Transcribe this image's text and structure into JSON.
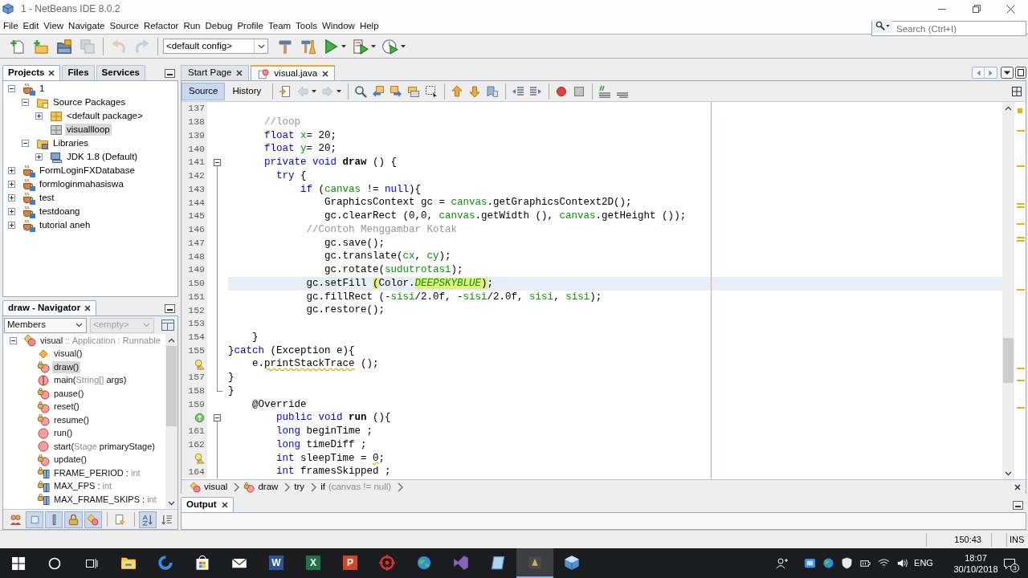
{
  "window": {
    "title": "1 - NetBeans IDE 8.0.2"
  },
  "menu": [
    "File",
    "Edit",
    "View",
    "Navigate",
    "Source",
    "Refactor",
    "Run",
    "Debug",
    "Profile",
    "Team",
    "Tools",
    "Window",
    "Help"
  ],
  "search": {
    "placeholder": "Search (Ctrl+I)"
  },
  "toolbar": [
    {
      "kind": "new-file",
      "disabled": false
    },
    {
      "kind": "new-project",
      "disabled": false
    },
    {
      "kind": "open-project",
      "disabled": false
    },
    {
      "kind": "save-all",
      "disabled": true
    },
    {
      "kind": "separator"
    },
    {
      "kind": "undo",
      "disabled": true
    },
    {
      "kind": "redo",
      "disabled": true
    },
    {
      "kind": "separator"
    },
    {
      "kind": "config",
      "value": "<default config>"
    },
    {
      "kind": "build",
      "disabled": false
    },
    {
      "kind": "clean-build",
      "disabled": false
    },
    {
      "kind": "run",
      "disabled": false
    },
    {
      "kind": "debug",
      "disabled": false
    },
    {
      "kind": "profile",
      "disabled": false
    }
  ],
  "projects": {
    "tabs": [
      {
        "label": "Projects",
        "selected": true,
        "closable": true
      },
      {
        "label": "Files",
        "selected": false,
        "closable": false
      },
      {
        "label": "Services",
        "selected": false,
        "closable": false
      }
    ],
    "tree": [
      {
        "kind": "project",
        "label": "1",
        "expanded": true,
        "selected": false,
        "children": [
          {
            "kind": "sources",
            "label": "Source Packages",
            "expanded": true,
            "selected": false,
            "children": [
              {
                "kind": "package",
                "label": "<default package>",
                "expanded": false,
                "selected": false
              },
              {
                "kind": "empty-package",
                "label": "visuallloop",
                "selected": true
              }
            ]
          },
          {
            "kind": "libraries",
            "label": "Libraries",
            "expanded": true,
            "selected": false,
            "children": [
              {
                "kind": "jdk",
                "label": "JDK 1.8 (Default)",
                "expanded": false,
                "selected": false
              }
            ]
          }
        ]
      },
      {
        "kind": "project",
        "label": "FormLoginFXDatabase",
        "expanded": false,
        "selected": false
      },
      {
        "kind": "project",
        "label": "formloginmahasiswa",
        "expanded": false,
        "selected": false
      },
      {
        "kind": "project",
        "label": "test",
        "expanded": false,
        "selected": false
      },
      {
        "kind": "project",
        "label": "testdoang",
        "expanded": false,
        "selected": false
      },
      {
        "kind": "project",
        "label": "tutorial aneh",
        "expanded": false,
        "selected": false
      }
    ]
  },
  "navigator": {
    "title": "draw - Navigator",
    "filter": {
      "value": "Members",
      "disabled": false
    },
    "scope": {
      "value": "<empty>",
      "disabled": true
    },
    "members": [
      {
        "kind": "class",
        "expanded": true,
        "selected": false,
        "parts": [
          {
            "kind": "name",
            "text": "visual"
          },
          {
            "kind": "type",
            "text": " :: Application : Runnable"
          }
        ],
        "children": [
          {
            "kind": "constructor",
            "selected": false,
            "parts": [
              {
                "kind": "name",
                "text": "visual()"
              }
            ]
          },
          {
            "kind": "private-method",
            "selected": true,
            "parts": [
              {
                "kind": "name",
                "text": "draw()"
              }
            ]
          },
          {
            "kind": "static-method",
            "selected": false,
            "parts": [
              {
                "kind": "name",
                "text": "main("
              },
              {
                "kind": "type",
                "text": "String[]"
              },
              {
                "kind": "name",
                "text": " args)"
              }
            ]
          },
          {
            "kind": "private-method",
            "selected": false,
            "parts": [
              {
                "kind": "name",
                "text": "pause()"
              }
            ]
          },
          {
            "kind": "private-method",
            "selected": false,
            "parts": [
              {
                "kind": "name",
                "text": "reset()"
              }
            ]
          },
          {
            "kind": "private-method",
            "selected": false,
            "parts": [
              {
                "kind": "name",
                "text": "resume()"
              }
            ]
          },
          {
            "kind": "public-method",
            "selected": false,
            "parts": [
              {
                "kind": "name",
                "text": "run()"
              }
            ]
          },
          {
            "kind": "public-method",
            "selected": false,
            "parts": [
              {
                "kind": "name",
                "text": "start("
              },
              {
                "kind": "type",
                "text": "Stage"
              },
              {
                "kind": "name",
                "text": " primaryStage)"
              }
            ]
          },
          {
            "kind": "private-method",
            "selected": false,
            "parts": [
              {
                "kind": "name",
                "text": "update()"
              }
            ]
          },
          {
            "kind": "private-field",
            "selected": false,
            "parts": [
              {
                "kind": "name",
                "text": "FRAME_PERIOD : "
              },
              {
                "kind": "type",
                "text": "int"
              }
            ]
          },
          {
            "kind": "private-field",
            "selected": false,
            "parts": [
              {
                "kind": "name",
                "text": "MAX_FPS : "
              },
              {
                "kind": "type",
                "text": "int"
              }
            ]
          },
          {
            "kind": "private-field",
            "selected": false,
            "parts": [
              {
                "kind": "name",
                "text": "MAX_FRAME_SKIPS : "
              },
              {
                "kind": "type",
                "text": "int"
              }
            ]
          }
        ]
      }
    ],
    "filters": [
      {
        "kind": "inherited",
        "on": false
      },
      {
        "kind": "fields",
        "on": true
      },
      {
        "kind": "static",
        "on": true
      },
      {
        "kind": "non-public",
        "on": true
      },
      {
        "kind": "inner-classes",
        "on": true
      },
      {
        "kind": "separator"
      },
      {
        "kind": "javadoc",
        "on": false
      },
      {
        "kind": "separator"
      },
      {
        "kind": "sort-name",
        "on": true
      },
      {
        "kind": "sort-source",
        "on": false
      }
    ]
  },
  "editor": {
    "tabs": [
      {
        "kind": "page",
        "label": "Start Page",
        "selected": false
      },
      {
        "kind": "java",
        "label": "visual.java",
        "selected": true
      }
    ],
    "views": [
      {
        "label": "Source",
        "selected": true
      },
      {
        "label": "History",
        "selected": false
      }
    ],
    "tools": [
      {
        "kind": "separator"
      },
      {
        "kind": "last-edit",
        "disabled": false
      },
      {
        "kind": "back",
        "disabled": true
      },
      {
        "kind": "forward",
        "disabled": true
      },
      {
        "kind": "separator"
      },
      {
        "kind": "find",
        "disabled": false
      },
      {
        "kind": "find-prev",
        "disabled": false
      },
      {
        "kind": "find-next",
        "disabled": false
      },
      {
        "kind": "highlight",
        "disabled": false
      },
      {
        "kind": "find-selection",
        "disabled": false
      },
      {
        "kind": "separator"
      },
      {
        "kind": "prev-bookmark",
        "disabled": false
      },
      {
        "kind": "next-bookmark",
        "disabled": false
      },
      {
        "kind": "toggle-bookmark",
        "disabled": false
      },
      {
        "kind": "separator"
      },
      {
        "kind": "shift-left",
        "disabled": false
      },
      {
        "kind": "shift-right",
        "disabled": false
      },
      {
        "kind": "separator"
      },
      {
        "kind": "record",
        "disabled": false
      },
      {
        "kind": "stop",
        "disabled": false
      },
      {
        "kind": "separator"
      },
      {
        "kind": "comment",
        "disabled": false
      },
      {
        "kind": "uncomment",
        "disabled": false
      }
    ],
    "lines": [
      {
        "number": "137",
        "kind": "plain",
        "current": false
      },
      {
        "number": "138",
        "kind": "plain",
        "current": false,
        "tokens": [
          {
            "kind": "comment",
            "text": "      //loop"
          }
        ]
      },
      {
        "number": "139",
        "kind": "plain",
        "current": false,
        "tokens": [
          {
            "kind": "keyword",
            "text": "      float "
          },
          {
            "kind": "field",
            "text": "x"
          },
          {
            "kind": "plain",
            "text": "= 20;"
          }
        ]
      },
      {
        "number": "140",
        "kind": "plain",
        "current": false,
        "tokens": [
          {
            "kind": "keyword",
            "text": "      float "
          },
          {
            "kind": "field",
            "text": "y"
          },
          {
            "kind": "plain",
            "text": "= 20;"
          }
        ]
      },
      {
        "number": "141",
        "kind": "fold-start",
        "current": false,
        "tokens": [
          {
            "kind": "keyword",
            "text": "      private void "
          },
          {
            "kind": "bold",
            "text": "draw"
          },
          {
            "kind": "plain",
            "text": " () {"
          }
        ]
      },
      {
        "number": "142",
        "kind": "fold-body",
        "current": false,
        "tokens": [
          {
            "kind": "keyword",
            "text": "        try"
          },
          {
            "kind": "plain",
            "text": " {"
          }
        ]
      },
      {
        "number": "143",
        "kind": "fold-body",
        "current": false,
        "tokens": [
          {
            "kind": "keyword",
            "text": "            if"
          },
          {
            "kind": "plain",
            "text": " ("
          },
          {
            "kind": "field",
            "text": "canvas"
          },
          {
            "kind": "plain",
            "text": " != "
          },
          {
            "kind": "keyword",
            "text": "null"
          },
          {
            "kind": "plain",
            "text": "){"
          }
        ]
      },
      {
        "number": "144",
        "kind": "fold-body",
        "current": false,
        "tokens": [
          {
            "kind": "plain",
            "text": "                GraphicsContext gc = "
          },
          {
            "kind": "field",
            "text": "canvas"
          },
          {
            "kind": "plain",
            "text": ".getGraphicsContext2D();"
          }
        ]
      },
      {
        "number": "145",
        "kind": "fold-body",
        "current": false,
        "tokens": [
          {
            "kind": "plain",
            "text": "                gc.clearRect (0,0, "
          },
          {
            "kind": "field",
            "text": "canvas"
          },
          {
            "kind": "plain",
            "text": ".getWidth (), "
          },
          {
            "kind": "field",
            "text": "canvas"
          },
          {
            "kind": "plain",
            "text": ".getHeight ());"
          }
        ]
      },
      {
        "number": "146",
        "kind": "fold-body",
        "current": false,
        "tokens": [
          {
            "kind": "comment",
            "text": "             //Contoh Menggambar Kotak"
          }
        ]
      },
      {
        "number": "147",
        "kind": "fold-body",
        "current": false,
        "tokens": [
          {
            "kind": "plain",
            "text": "                gc.save();"
          }
        ]
      },
      {
        "number": "148",
        "kind": "fold-body",
        "current": false,
        "tokens": [
          {
            "kind": "plain",
            "text": "                gc.translate("
          },
          {
            "kind": "field",
            "text": "cx"
          },
          {
            "kind": "plain",
            "text": ", "
          },
          {
            "kind": "field",
            "text": "cy"
          },
          {
            "kind": "plain",
            "text": ");"
          }
        ]
      },
      {
        "number": "149",
        "kind": "fold-body",
        "current": false,
        "tokens": [
          {
            "kind": "plain",
            "text": "                gc.rotate("
          },
          {
            "kind": "field",
            "text": "sudutrotasi"
          },
          {
            "kind": "plain",
            "text": ");"
          }
        ]
      },
      {
        "number": "150",
        "kind": "fold-body",
        "current": true,
        "tokens": [
          {
            "kind": "plain",
            "text": "             gc.setFill "
          },
          {
            "kind": "brace",
            "text": "("
          },
          {
            "kind": "plain",
            "text": "Color."
          },
          {
            "kind": "marked",
            "text": "DEEPSKYBLUE"
          },
          {
            "kind": "brace",
            "text": ")"
          },
          {
            "kind": "plain",
            "text": ";"
          }
        ]
      },
      {
        "number": "151",
        "kind": "fold-body",
        "current": false,
        "tokens": [
          {
            "kind": "plain",
            "text": "             gc.fillRect (-"
          },
          {
            "kind": "field",
            "text": "sisi"
          },
          {
            "kind": "plain",
            "text": "/2.0f, -"
          },
          {
            "kind": "field",
            "text": "sisi"
          },
          {
            "kind": "plain",
            "text": "/2.0f, "
          },
          {
            "kind": "field",
            "text": "sisi"
          },
          {
            "kind": "plain",
            "text": ", "
          },
          {
            "kind": "field",
            "text": "sisi"
          },
          {
            "kind": "plain",
            "text": ");"
          }
        ]
      },
      {
        "number": "152",
        "kind": "fold-body",
        "current": false,
        "tokens": [
          {
            "kind": "plain",
            "text": "             gc.restore();"
          }
        ]
      },
      {
        "number": "153",
        "kind": "fold-body",
        "current": false
      },
      {
        "number": "154",
        "kind": "fold-body",
        "current": false,
        "tokens": [
          {
            "kind": "plain",
            "text": "    }"
          }
        ]
      },
      {
        "number": "155",
        "kind": "fold-body",
        "current": false,
        "tokens": [
          {
            "kind": "plain",
            "text": "}"
          },
          {
            "kind": "keyword",
            "text": "catch"
          },
          {
            "kind": "plain",
            "text": " (Exception e){"
          }
        ]
      },
      {
        "annotation": {
          "kind": "hint"
        },
        "kind": "fold-body",
        "current": false,
        "tokens": [
          {
            "kind": "plain",
            "text": "    e."
          },
          {
            "kind": "warning",
            "text": "printStackTrace"
          },
          {
            "kind": "plain",
            "text": " ();"
          }
        ]
      },
      {
        "number": "157",
        "kind": "fold-body",
        "current": false,
        "tokens": [
          {
            "kind": "plain",
            "text": "}"
          }
        ]
      },
      {
        "number": "158",
        "kind": "fold-end",
        "current": false,
        "tokens": [
          {
            "kind": "plain",
            "text": "}"
          }
        ]
      },
      {
        "number": "159",
        "kind": "plain",
        "current": false,
        "tokens": [
          {
            "kind": "plain",
            "text": "    @Override"
          }
        ]
      },
      {
        "annotation": {
          "kind": "override"
        },
        "kind": "fold-start",
        "current": false,
        "tokens": [
          {
            "kind": "keyword",
            "text": "        public void "
          },
          {
            "kind": "bold",
            "text": "run"
          },
          {
            "kind": "plain",
            "text": " (){"
          }
        ]
      },
      {
        "number": "161",
        "kind": "fold-body",
        "current": false,
        "tokens": [
          {
            "kind": "keyword",
            "text": "        long"
          },
          {
            "kind": "plain",
            "text": " beginTime ;"
          }
        ]
      },
      {
        "number": "162",
        "kind": "fold-body",
        "current": false,
        "tokens": [
          {
            "kind": "keyword",
            "text": "        long"
          },
          {
            "kind": "plain",
            "text": " timeDiff ;"
          }
        ]
      },
      {
        "annotation": {
          "kind": "hint"
        },
        "kind": "fold-body",
        "current": false,
        "tokens": [
          {
            "kind": "keyword",
            "text": "        int"
          },
          {
            "kind": "plain",
            "text": " sleepTime = "
          },
          {
            "kind": "warning",
            "text": "0"
          },
          {
            "kind": "plain",
            "text": ";"
          }
        ]
      },
      {
        "number": "164",
        "kind": "fold-body",
        "current": false,
        "tokens": [
          {
            "kind": "keyword",
            "text": "        int"
          },
          {
            "kind": "plain",
            "text": " framesSkipped ;"
          }
        ]
      }
    ],
    "breadcrumbs": [
      {
        "kind": "class",
        "label": "visual"
      },
      {
        "kind": "method",
        "label": "draw"
      },
      {
        "kind": "block",
        "label": "try"
      },
      {
        "kind": "block",
        "label": "if",
        "detail": "(canvas != null)"
      }
    ]
  },
  "output": {
    "title": "Output"
  },
  "status_bar": {
    "position": "150:43",
    "mode": "INS"
  },
  "taskbar": {
    "apps": [
      {
        "kind": "explorer",
        "active": false
      },
      {
        "kind": "edge",
        "active": false
      },
      {
        "kind": "store",
        "active": false
      },
      {
        "kind": "mail",
        "active": false
      },
      {
        "kind": "word",
        "letter": "W",
        "active": false
      },
      {
        "kind": "excel",
        "letter": "X",
        "active": false
      },
      {
        "kind": "powerpoint",
        "letter": "P",
        "active": false
      },
      {
        "kind": "target",
        "active": false
      },
      {
        "kind": "globe",
        "active": false
      },
      {
        "kind": "ribbon",
        "active": false
      },
      {
        "kind": "notepad",
        "active": false
      },
      {
        "kind": "ide",
        "active": true
      },
      {
        "kind": "cube",
        "active": false
      }
    ],
    "language": "ENG",
    "time": "18:07",
    "date": "30/10/2018",
    "notifications": "3"
  }
}
